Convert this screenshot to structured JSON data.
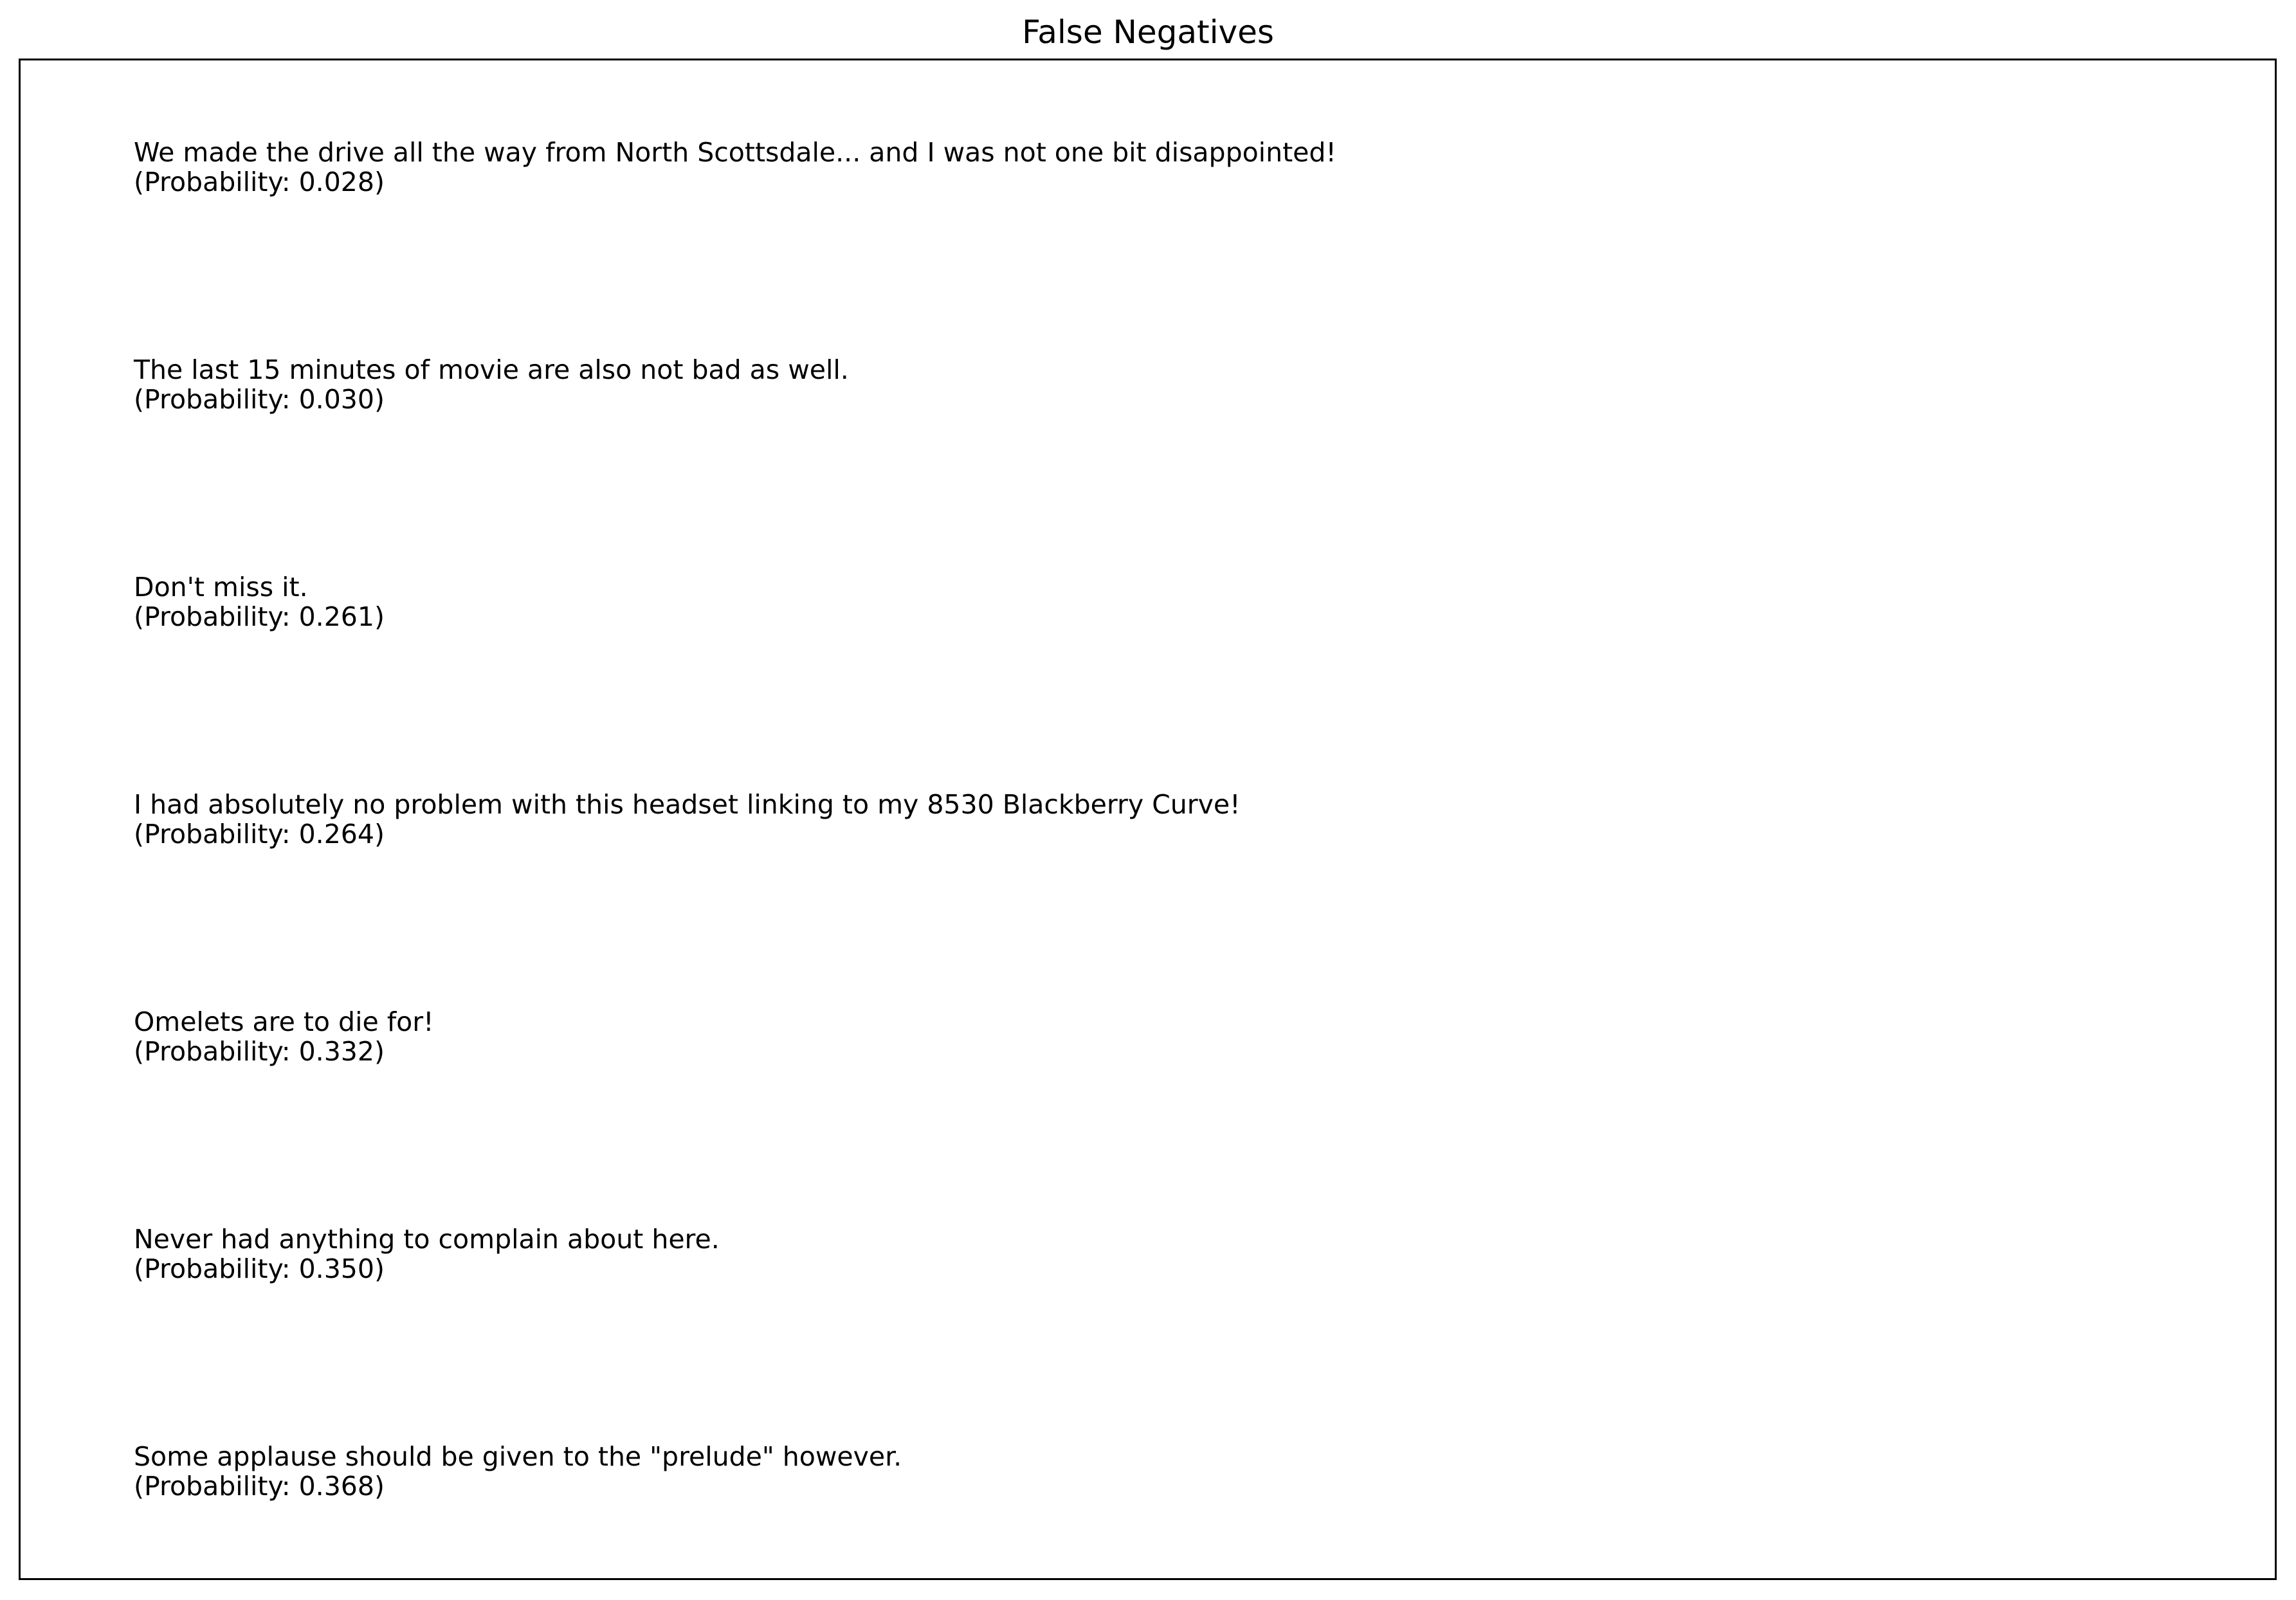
{
  "title": "False Negatives",
  "entries": [
    {
      "text": "We made the drive all the way from North Scottsdale... and I was not one bit disappointed!",
      "probability": "(Probability: 0.028)"
    },
    {
      "text": "The last 15 minutes of movie are also not bad as well.",
      "probability": "(Probability: 0.030)"
    },
    {
      "text": "Don't miss it.",
      "probability": "(Probability: 0.261)"
    },
    {
      "text": "I had absolutely no problem with this headset linking to my 8530 Blackberry Curve!",
      "probability": "(Probability: 0.264)"
    },
    {
      "text": "Omelets are to die for!",
      "probability": "(Probability: 0.332)"
    },
    {
      "text": "Never had anything to complain about here.",
      "probability": "(Probability: 0.350)"
    },
    {
      "text": "Some applause should be given to the \"prelude\" however.",
      "probability": "(Probability: 0.368)"
    }
  ]
}
